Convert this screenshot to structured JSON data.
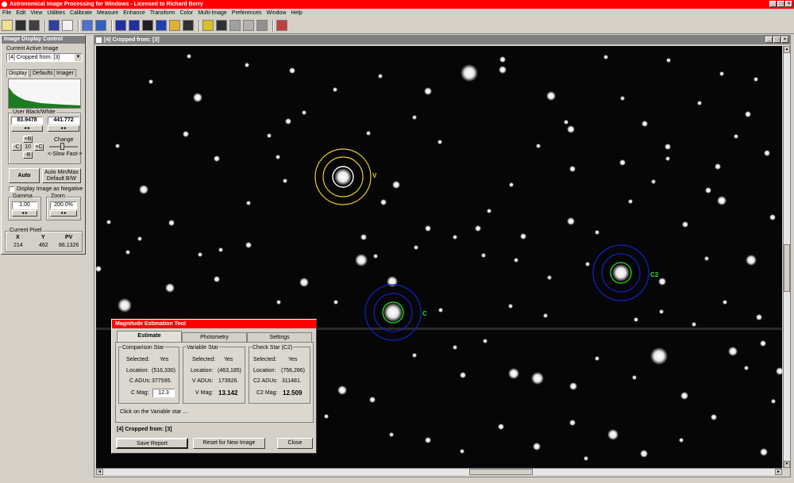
{
  "app": {
    "title": "Astronomical Image Processing for Windows - Licensed to Richard Berry",
    "window_buttons": [
      "_",
      "□",
      "×"
    ]
  },
  "menu": [
    "File",
    "Edit",
    "View",
    "Utilities",
    "Calibrate",
    "Measure",
    "Enhance",
    "Transform",
    "Color",
    "Multi-Image",
    "Preferences",
    "Window",
    "Help"
  ],
  "colors": {
    "title_red": "#ff0000",
    "circle_blue": "#1020c0",
    "circle_green": "#20e020",
    "circle_yellow": "#e8d020"
  },
  "display_control": {
    "title": "Image Display Control",
    "current_image_label": "Current Active Image",
    "current_image_value": "[4] Cropped from: [3]",
    "tabs": [
      "Display",
      "Defaults",
      "Imager"
    ],
    "user_bw_label": "User Black/White",
    "black_value": "83.9478",
    "white_value": "441.772",
    "plus_b": "+B",
    "minus_b": "-B",
    "minus_c": "-C",
    "plus_c": "+C",
    "step_value": "10",
    "change_label": "Change",
    "slow_fast_label": "<-Slow Fast->",
    "auto_button": "Auto",
    "auto_minmax_button": "Auto Min/Max",
    "default_bw_button": "Default B/W",
    "negative_label": "Display Image as Negative",
    "gamma_label": "Gamma",
    "gamma_value": "1.00",
    "zoom_label": "Zoom",
    "zoom_value": "200.0%",
    "pixel_label": "Current Pixel",
    "x_label": "X",
    "y_label": "Y",
    "pv_label": "PV",
    "x_value": "214",
    "y_value": "462",
    "pv_value": "86.1326"
  },
  "image_window": {
    "title": "[4] Cropped from: [3]",
    "labels": {
      "v": "V",
      "c": "C",
      "c2": "C2"
    }
  },
  "tool": {
    "title": "Magnitude Estimation Tool",
    "tabs": [
      "Estimate",
      "Photometry",
      "Settings"
    ],
    "comparison": {
      "title": "Comparison Star",
      "selected_label": "Selected:",
      "selected_value": "Yes",
      "location_label": "Location:",
      "location_value": "(516,330)",
      "adus_label": "C ADUs:",
      "adus_value": "377595.",
      "mag_label": "C Mag:",
      "mag_value": "12.3"
    },
    "variable": {
      "title": "Variable Star",
      "selected_label": "Selected:",
      "selected_value": "Yes",
      "location_label": "Location:",
      "location_value": "(463,185)",
      "adus_label": "V ADUs:",
      "adus_value": "173926.",
      "mag_label": "V Mag:",
      "mag_value": "13.142"
    },
    "check": {
      "title": "Check Star (C2)",
      "selected_label": "Selected:",
      "selected_value": "Yes",
      "location_label": "Location:",
      "location_value": "(756,286)",
      "adus_label": "C2 ADUs:",
      "adus_value": "311481.",
      "mag_label": "C2 Mag:",
      "mag_value": "12.509"
    },
    "hint": "Click on the Variable star ...",
    "image_name": "[4] Cropped from: [3]",
    "save_button": "Save Report",
    "reset_button": "Reset for New Image",
    "close_button": "Close"
  }
}
